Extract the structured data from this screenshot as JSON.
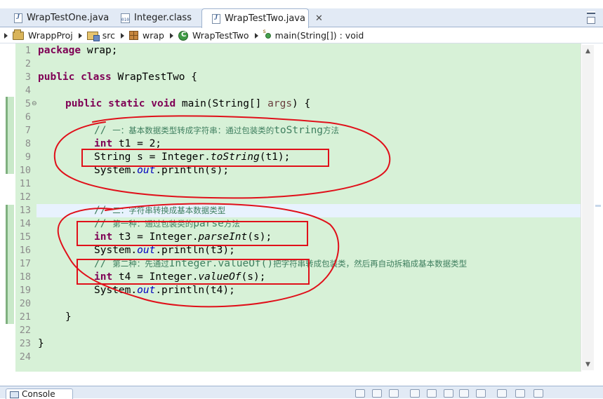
{
  "tabs": [
    {
      "label": "WrapTestOne.java",
      "icon": "java-file-icon",
      "active": false
    },
    {
      "label": "Integer.class",
      "icon": "class-file-icon",
      "active": false
    },
    {
      "label": "WrapTestTwo.java",
      "icon": "java-file-icon",
      "active": true,
      "close": "✕"
    }
  ],
  "breadcrumb": [
    {
      "label": "WrappProj",
      "icon": "project-icon"
    },
    {
      "label": "src",
      "icon": "source-folder-icon"
    },
    {
      "label": "wrap",
      "icon": "package-icon"
    },
    {
      "label": "WrapTestTwo",
      "icon": "class-icon"
    },
    {
      "label": "main(String[]) : void",
      "icon": "method-icon"
    }
  ],
  "editor": {
    "current_line": 13,
    "line_numbers": [
      "1",
      "2",
      "3",
      "4",
      "5",
      "6",
      "7",
      "8",
      "9",
      "10",
      "11",
      "12",
      "13",
      "14",
      "15",
      "16",
      "17",
      "18",
      "19",
      "20",
      "21",
      "22",
      "23",
      "24"
    ],
    "folding_marker": "⊖",
    "code": {
      "l1_kw": "package",
      "l1_rest": " wrap;",
      "l3_kw1": "public",
      "l3_kw2": "class",
      "l3_rest": " WrapTestTwo {",
      "l5_kw1": "public",
      "l5_kw2": "static",
      "l5_kw3": "void",
      "l5_rest": " main(String[] ",
      "l5_param": "args",
      "l5_end": ") {",
      "l7_prefix": "// ",
      "l7_zh": "一：基本数据类型转成字符串：通过包装类的",
      "l7_code": "toString",
      "l7_zh2": "方法",
      "l8_kw": "int",
      "l8_rest": " t1 = 2;",
      "l9_a": "String s = Integer.",
      "l9_method": "toString",
      "l9_b": "(t1);",
      "l10_a": "System.",
      "l10_field": "out",
      "l10_b": ".println(s);",
      "l13_prefix": "// ",
      "l13_zh": "二：字符串转换成基本数据类型",
      "l14_prefix": "// ",
      "l14_zh": "第一种：通过包装类的",
      "l14_code": "parse",
      "l14_zh2": "方法",
      "l15_kw": "int",
      "l15_a": " t3 = Integer.",
      "l15_method": "parseInt",
      "l15_b": "(s);",
      "l16_a": "System.",
      "l16_field": "out",
      "l16_b": ".println(t3);",
      "l17_prefix": "// ",
      "l17_zh": "第二种：先通过",
      "l17_code": "Integer.valueOf()",
      "l17_zh2": "把字符串转成包装类，然后再自动拆箱成基本数据类型",
      "l18_kw": "int",
      "l18_a": " t4 = Integer.",
      "l18_method": "valueOf",
      "l18_b": "(s);",
      "l19_a": "System.",
      "l19_field": "out",
      "l19_b": ".println(t4);",
      "l21": "}",
      "l23": "}"
    }
  },
  "console": {
    "label": "Console",
    "close": "✕"
  },
  "colors": {
    "editor_bg": "#d7f1d7",
    "keyword": "#7f0055",
    "comment": "#3f7f5f",
    "field": "#0000c0",
    "annotation": "#e0101a",
    "current_line": "#e8f2fe"
  }
}
